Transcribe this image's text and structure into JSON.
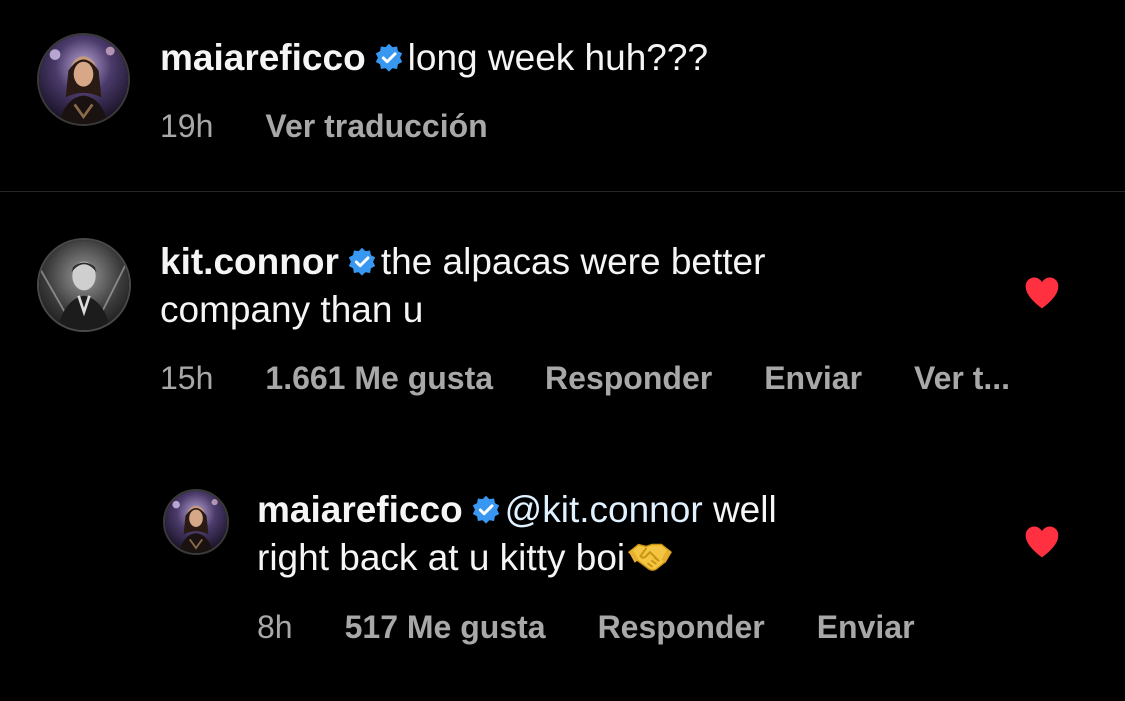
{
  "caption": {
    "username": "maiareficco",
    "text": "long week huh???",
    "time": "19h",
    "translate_label": "Ver traducción"
  },
  "comments": [
    {
      "username": "kit.connor",
      "text_line1": "the alpacas were better",
      "text_line2": "company than u",
      "time": "15h",
      "likes": "1.661 Me gusta",
      "reply_label": "Responder",
      "send_label": "Enviar",
      "translate_label": "Ver t...",
      "liked": true
    }
  ],
  "replies": [
    {
      "username": "maiareficco",
      "mention": "@kit.connor",
      "text_line1": "well",
      "text_line2": "right back at u kitty boi",
      "emoji": "handshake-emoji",
      "time": "8h",
      "likes": "517 Me gusta",
      "reply_label": "Responder",
      "send_label": "Enviar",
      "liked": true
    }
  ],
  "colors": {
    "background": "#000000",
    "text": "#f5f5f5",
    "secondary_text": "#a8a8a8",
    "verified": "#3897f0",
    "heart": "#ff3040",
    "divider": "#262626"
  },
  "icons": [
    "verified-badge-icon",
    "heart-icon",
    "handshake-emoji"
  ]
}
